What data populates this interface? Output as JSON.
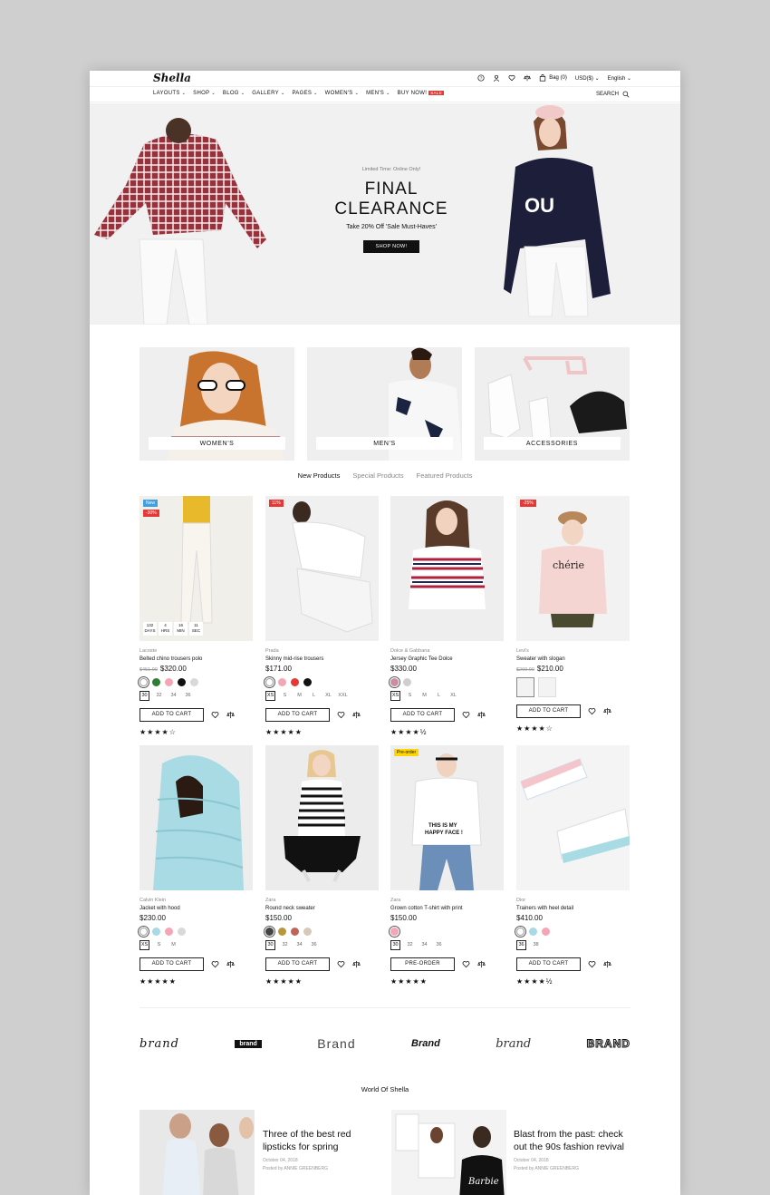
{
  "header": {
    "logo": "Shella",
    "bag": "Bag (0)",
    "currency": "USD($)",
    "language": "English"
  },
  "nav": {
    "items": [
      "LAYOUTS",
      "SHOP",
      "BLOG",
      "GALLERY",
      "PAGES",
      "WOMEN'S",
      "MEN'S",
      "BUY NOW!"
    ],
    "sale_badge": "SALE",
    "search": "SEARCH"
  },
  "hero": {
    "kicker": "Limited Time: Online Only!",
    "title_line1": "FINAL",
    "title_line2": "CLEARANCE",
    "subtitle": "Take 20% Off 'Sale Must-Haves'",
    "button": "SHOP NOW!"
  },
  "categories": [
    "WOMEN'S",
    "MEN'S",
    "ACCESSORIES"
  ],
  "tabs": [
    "New Products",
    "Special Products",
    "Featured Products"
  ],
  "products": [
    {
      "brand": "Lacoste",
      "name": "Belted chino trousers polo",
      "old_price": "$451.00",
      "price": "$320.00",
      "badges": [
        "New",
        "-30%"
      ],
      "countdown": [
        {
          "v": "132",
          "l": "DAYS"
        },
        {
          "v": "4",
          "l": "HRS"
        },
        {
          "v": "16",
          "l": "MIN"
        },
        {
          "v": "11",
          "l": "SEC"
        }
      ],
      "swatches": [
        "#ffffff",
        "#2e7d32",
        "#f4a6b7",
        "#111111",
        "#d9d9d9"
      ],
      "sizes": [
        "30",
        "32",
        "34",
        "36"
      ],
      "button": "ADD TO CART",
      "stars": "★★★★☆"
    },
    {
      "brand": "Prada",
      "name": "Skinny mid-rise trousers",
      "old_price": "",
      "price": "$171.00",
      "badges": [
        "11%"
      ],
      "swatches": [
        "#ffffff",
        "#f4a6b7",
        "#e53935",
        "#111111"
      ],
      "sizes": [
        "XS",
        "S",
        "M",
        "L",
        "XL",
        "XXL"
      ],
      "button": "ADD TO CART",
      "stars": "★★★★★"
    },
    {
      "brand": "Dolce & Gabbana",
      "name": "Jersey Graphic Tee Dolce",
      "old_price": "",
      "price": "$330.00",
      "badges": [],
      "swatches": [
        "#c98fa0",
        "#cfcfcf"
      ],
      "sizes": [
        "XS",
        "S",
        "M",
        "L",
        "XL"
      ],
      "button": "ADD TO CART",
      "stars": "★★★★½"
    },
    {
      "brand": "Levi's",
      "name": "Sweater with slogan",
      "old_price": "$260.00",
      "price": "$210.00",
      "badges": [
        "-25%"
      ],
      "thumbs": 2,
      "button": "ADD TO CART",
      "stars": "★★★★☆"
    },
    {
      "brand": "Calvin Klein",
      "name": "Jacket with hood",
      "old_price": "",
      "price": "$230.00",
      "badges": [],
      "swatches": [
        "#ffffff",
        "#a9d8e8",
        "#f4a6b7",
        "#d9d9d9"
      ],
      "sizes": [
        "XS",
        "S",
        "M"
      ],
      "button": "ADD TO CART",
      "stars": "★★★★★"
    },
    {
      "brand": "Zara",
      "name": "Round neck sweater",
      "old_price": "",
      "price": "$150.00",
      "badges": [],
      "swatches": [
        "#444444",
        "#b8973a",
        "#c0645a",
        "#d8c8b8"
      ],
      "sizes": [
        "30",
        "32",
        "34",
        "36"
      ],
      "button": "ADD TO CART",
      "stars": "★★★★★"
    },
    {
      "brand": "Zara",
      "name": "Grown cotton T-shirt with print",
      "old_price": "",
      "price": "$150.00",
      "badges": [
        "Pre-order"
      ],
      "swatches": [
        "#f4a6b7"
      ],
      "sizes": [
        "30",
        "32",
        "34",
        "36"
      ],
      "button": "PRE-ORDER",
      "stars": "★★★★★"
    },
    {
      "brand": "Dior",
      "name": "Trainers with heel detail",
      "old_price": "",
      "price": "$410.00",
      "badges": [],
      "swatches": [
        "#ffffff",
        "#a9d8e8",
        "#f4a6b7"
      ],
      "sizes": [
        "36",
        "38"
      ],
      "button": "ADD TO CART",
      "stars": "★★★★½"
    }
  ],
  "brands": [
    "brand",
    "brand",
    "Brand",
    "Brand",
    "brand",
    "BRAND"
  ],
  "blog": {
    "heading": "World Of Shella",
    "posts": [
      {
        "title": "Three of the best red lipsticks for spring",
        "date": "October 04, 2018",
        "by": "Posted by ANNIE GREENBERG"
      },
      {
        "title": "Blast from the past: check out the 90s fashion revival",
        "date": "October 04, 2018",
        "by": "Posted by ANNIE GREENBERG"
      }
    ]
  },
  "colors": {
    "accent": "#e53935",
    "new_badge": "#3f9fe0",
    "preorder_badge": "#ffd600"
  }
}
